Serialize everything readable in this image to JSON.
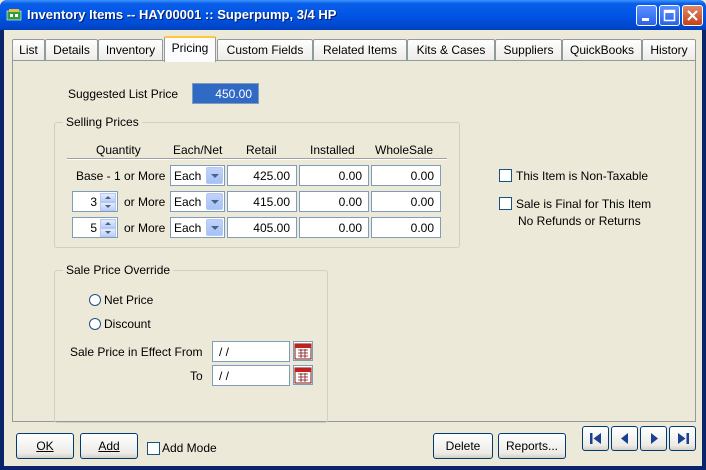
{
  "window": {
    "title": "Inventory Items -- HAY00001 :: Superpump, 3/4 HP"
  },
  "tabs": [
    {
      "label": "List"
    },
    {
      "label": "Details"
    },
    {
      "label": "Inventory"
    },
    {
      "label": "Pricing"
    },
    {
      "label": "Custom Fields"
    },
    {
      "label": "Related Items"
    },
    {
      "label": "Kits & Cases"
    },
    {
      "label": "Suppliers"
    },
    {
      "label": "QuickBooks"
    },
    {
      "label": "History"
    }
  ],
  "active_tab": "Pricing",
  "pricing": {
    "suggested_list_price_label": "Suggested List Price",
    "suggested_list_price": "450.00",
    "selling_prices": {
      "title": "Selling Prices",
      "headers": [
        "Quantity",
        "Each/Net",
        "Retail",
        "Installed",
        "WholeSale"
      ],
      "rows": [
        {
          "qty_label": "Base - 1 or More",
          "unit": "Each",
          "retail": "425.00",
          "installed": "0.00",
          "wholesale": "0.00"
        },
        {
          "qty": "3",
          "or_more": "or More",
          "unit": "Each",
          "retail": "415.00",
          "installed": "0.00",
          "wholesale": "0.00"
        },
        {
          "qty": "5",
          "or_more": "or More",
          "unit": "Each",
          "retail": "405.00",
          "installed": "0.00",
          "wholesale": "0.00"
        }
      ]
    },
    "non_taxable_label": "This Item is Non-Taxable",
    "sale_final_label": "Sale is Final for This Item",
    "no_refunds_label": "No Refunds or Returns",
    "sale_override": {
      "title": "Sale Price Override",
      "net_price_label": "Net Price",
      "discount_label": "Discount",
      "effect_from_label": "Sale Price in Effect From",
      "from_value": "/ /",
      "to_label": "To",
      "to_value": "/ /"
    }
  },
  "footer": {
    "ok": "OK",
    "add": "Add",
    "add_mode": "Add Mode",
    "delete": "Delete",
    "reports": "Reports..."
  },
  "colors": {
    "titlebar": "#0055e5",
    "selected_field": "#316ac5",
    "panel": "#ece9d8"
  }
}
